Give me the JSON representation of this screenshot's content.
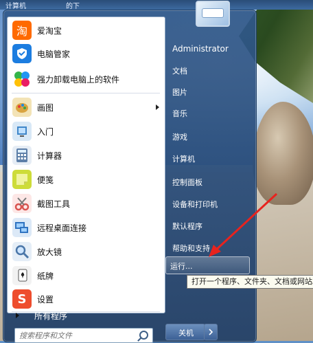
{
  "taskbar_top": {
    "item1": "计算机",
    "item2": "的下"
  },
  "left_pane": {
    "items": [
      {
        "label": "爱淘宝",
        "icon": "taobao-icon",
        "color": "#ff6a00"
      },
      {
        "label": "电脑管家",
        "icon": "shield-icon",
        "color": "#1c7de0"
      },
      {
        "label": "强力卸载电脑上的软件",
        "icon": "pinwheel-icon",
        "color": "#33b54a"
      },
      {
        "label": "画图",
        "icon": "palette-icon",
        "color": "#d9a441"
      },
      {
        "label": "入门",
        "icon": "getting-started-icon",
        "color": "#3f86c9"
      },
      {
        "label": "计算器",
        "icon": "calculator-icon",
        "color": "#5d7fa8"
      },
      {
        "label": "便笺",
        "icon": "sticky-note-icon",
        "color": "#cddc39"
      },
      {
        "label": "截图工具",
        "icon": "scissors-icon",
        "color": "#d9534f"
      },
      {
        "label": "远程桌面连接",
        "icon": "remote-desktop-icon",
        "color": "#2f73c0"
      },
      {
        "label": "放大镜",
        "icon": "magnifier-icon",
        "color": "#4a76a8"
      },
      {
        "label": "纸牌",
        "icon": "cards-icon",
        "color": "#6d8f45"
      },
      {
        "label": "设置",
        "icon": "sogou-icon",
        "color": "#ee4d2d"
      }
    ],
    "all_programs": "所有程序"
  },
  "search": {
    "placeholder": "搜索程序和文件"
  },
  "right_pane": {
    "user": "Administrator",
    "items": [
      "文档",
      "图片",
      "音乐",
      "游戏",
      "计算机",
      "控制面板",
      "设备和打印机",
      "默认程序",
      "帮助和支持"
    ],
    "run": "运行...",
    "tooltip": "打开一个程序、文件夹、文档或网站。",
    "shutdown": "关机"
  }
}
